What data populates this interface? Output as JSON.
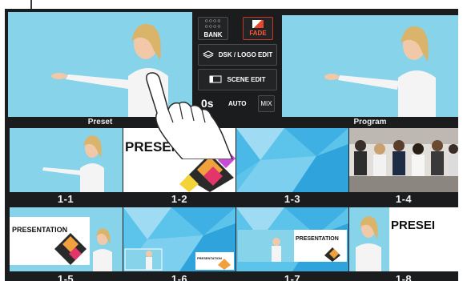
{
  "monitors": {
    "preset_label": "Preset",
    "program_label": "Program"
  },
  "controls": {
    "bank_label": "BANK",
    "fade_label": "FADE",
    "dsk_label": "DSK / LOGO EDIT",
    "scene_edit_label": "SCENE EDIT",
    "time_label": "0s",
    "auto_label": "AUTO",
    "mix_label": "MIX"
  },
  "scenes": [
    {
      "label": "1-1",
      "kind": "presenter"
    },
    {
      "label": "1-2",
      "kind": "slide",
      "text": "PRESENT"
    },
    {
      "label": "1-3",
      "kind": "blue"
    },
    {
      "label": "1-4",
      "kind": "audience"
    },
    {
      "label": "1-5",
      "kind": "slide-presenter",
      "text": "PRESENTATION"
    },
    {
      "label": "1-6",
      "kind": "blue-pip",
      "text": "PRESENTATION"
    },
    {
      "label": "1-7",
      "kind": "pip-slide",
      "text": "PRESENTATION"
    },
    {
      "label": "1-8",
      "kind": "presenter-slide",
      "text": "PRESEI"
    }
  ],
  "colors": {
    "selected": "#6fcf52",
    "fade": "#e8452c",
    "background": "#1b1c1e"
  },
  "icons": {
    "bank": "grid-dots-icon",
    "fade": "fade-icon",
    "dsk": "layers-icon",
    "scene": "screen-icon",
    "gesture": "hand-tap-icon"
  }
}
